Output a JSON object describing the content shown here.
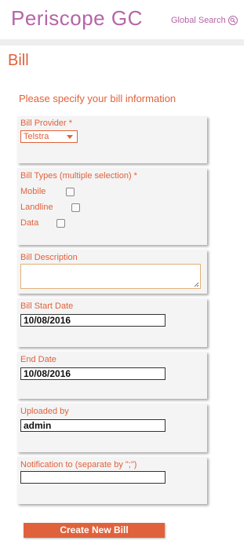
{
  "header": {
    "app_title": "Periscope GC",
    "global_search_label": "Global Search"
  },
  "page": {
    "title": "Bill",
    "instruction": "Please specify your bill information"
  },
  "form": {
    "bill_provider": {
      "label": "Bill Provider *",
      "selected": "Telstra"
    },
    "bill_types": {
      "label": "Bill Types (multiple selection) *",
      "options": [
        {
          "label": "Mobile",
          "checked": false
        },
        {
          "label": "Landline",
          "checked": false
        },
        {
          "label": "Data",
          "checked": false
        }
      ]
    },
    "bill_description": {
      "label": "Bill Description",
      "value": ""
    },
    "bill_start_date": {
      "label": "Bill Start Date",
      "value": "10/08/2016"
    },
    "end_date": {
      "label": "End Date",
      "value": "10/08/2016"
    },
    "uploaded_by": {
      "label": "Uploaded by",
      "value": "admin"
    },
    "notification_to": {
      "label": "Notification to (separate by \";\")",
      "value": ""
    },
    "submit_label": "Create New Bill"
  },
  "colors": {
    "brand": "#b565a7",
    "accent": "#e0623c",
    "card": "#f4f4f4"
  }
}
